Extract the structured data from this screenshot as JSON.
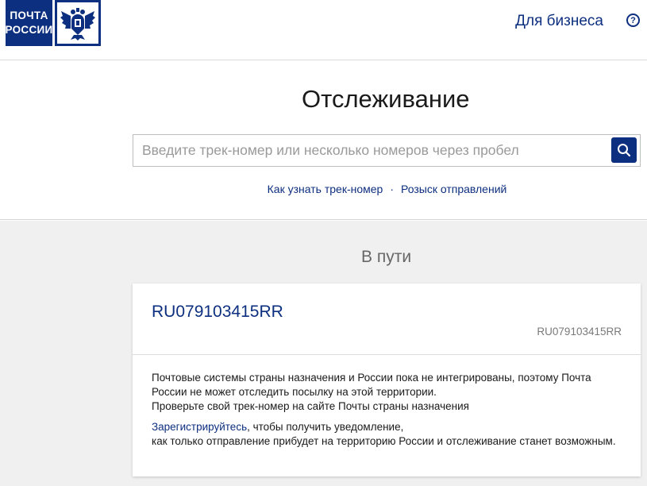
{
  "header": {
    "logo_line1": "ПОЧТА",
    "logo_line2": "РОССИИ",
    "business_link": "Для бизнеса",
    "help_label": "?"
  },
  "search": {
    "title": "Отслеживание",
    "placeholder": "Введите трек-номер или несколько номеров через пробел",
    "value": "",
    "link_how": "Как узнать трек-номер",
    "separator": "·",
    "link_search": "Розыск отправлений"
  },
  "result": {
    "status": "В пути",
    "track_number": "RU079103415RR",
    "track_number_secondary": "RU079103415RR",
    "message_line1": "Почтовые системы страны назначения и России пока не интегрированы, поэтому Почта России не может отследить посылку на этой территории.",
    "message_line2": "Проверьте свой трек-номер на сайте Почты страны назначения",
    "register_link": "Зарегистрируйтесь",
    "register_text1": ", чтобы получить уведомление,",
    "register_text2": "как только отправление прибудет на территорию России и отслеживание станет возможным."
  },
  "colors": {
    "brand": "#0d2f7f",
    "gray_bg": "#f0f0f0"
  }
}
